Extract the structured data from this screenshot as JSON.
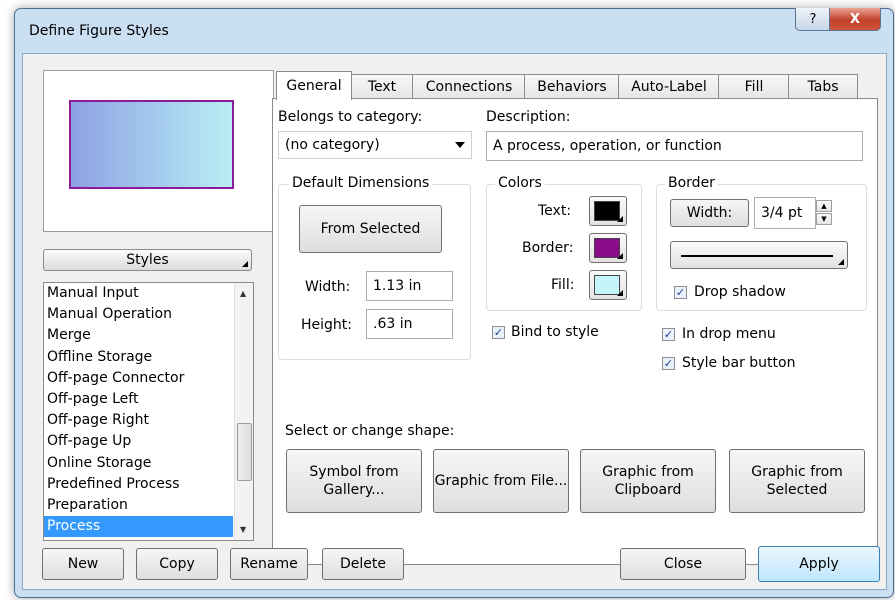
{
  "window": {
    "title": "Define Figure Styles",
    "help_glyph": "?",
    "close_glyph": "X"
  },
  "styles_panel": {
    "header_button": "Styles",
    "items": [
      {
        "label": "Manual Input",
        "selected": false
      },
      {
        "label": "Manual Operation",
        "selected": false
      },
      {
        "label": "Merge",
        "selected": false
      },
      {
        "label": "Offline Storage",
        "selected": false
      },
      {
        "label": "Off-page Connector",
        "selected": false
      },
      {
        "label": "Off-page Left",
        "selected": false
      },
      {
        "label": "Off-page Right",
        "selected": false
      },
      {
        "label": "Off-page Up",
        "selected": false
      },
      {
        "label": "Online Storage",
        "selected": false
      },
      {
        "label": "Predefined Process",
        "selected": false
      },
      {
        "label": "Preparation",
        "selected": false
      },
      {
        "label": "Process",
        "selected": true
      }
    ]
  },
  "tabs": [
    {
      "label": "General",
      "active": true
    },
    {
      "label": "Text",
      "active": false
    },
    {
      "label": "Connections",
      "active": false
    },
    {
      "label": "Behaviors",
      "active": false
    },
    {
      "label": "Auto-Label",
      "active": false
    },
    {
      "label": "Fill",
      "active": false
    },
    {
      "label": "Tabs",
      "active": false
    }
  ],
  "general": {
    "category_label": "Belongs to category:",
    "category_value": "(no category)",
    "description_label": "Description:",
    "description_value": "A process, operation, or function",
    "dimensions": {
      "group_title": "Default Dimensions",
      "from_selected": "From Selected",
      "width_label": "Width:",
      "width_value": "1.13 in",
      "height_label": "Height:",
      "height_value": ".63 in"
    },
    "colors": {
      "group_title": "Colors",
      "text_label": "Text:",
      "text_color": "#000000",
      "border_label": "Border:",
      "border_color": "#8b0c8b",
      "fill_label": "Fill:",
      "fill_color": "#c6f4fb"
    },
    "border": {
      "group_title": "Border",
      "width_button": "Width:",
      "width_value": "3/4 pt",
      "drop_shadow": "Drop shadow",
      "drop_shadow_checked": true
    },
    "bind_to_style": "Bind to style",
    "bind_to_style_checked": true,
    "in_drop_menu": "In drop menu",
    "in_drop_menu_checked": true,
    "style_bar_button": "Style bar button",
    "style_bar_button_checked": true,
    "shape_label": "Select or change shape:",
    "shape_buttons": [
      "Symbol from Gallery...",
      "Graphic from File...",
      "Graphic from Clipboard",
      "Graphic from Selected"
    ]
  },
  "footer": {
    "new": "New",
    "copy": "Copy",
    "rename": "Rename",
    "delete": "Delete",
    "close": "Close",
    "apply": "Apply"
  },
  "preview": {
    "border_color": "#8b1a9c",
    "fill_gradient": [
      "#8da1e4",
      "#b9eef4"
    ]
  }
}
